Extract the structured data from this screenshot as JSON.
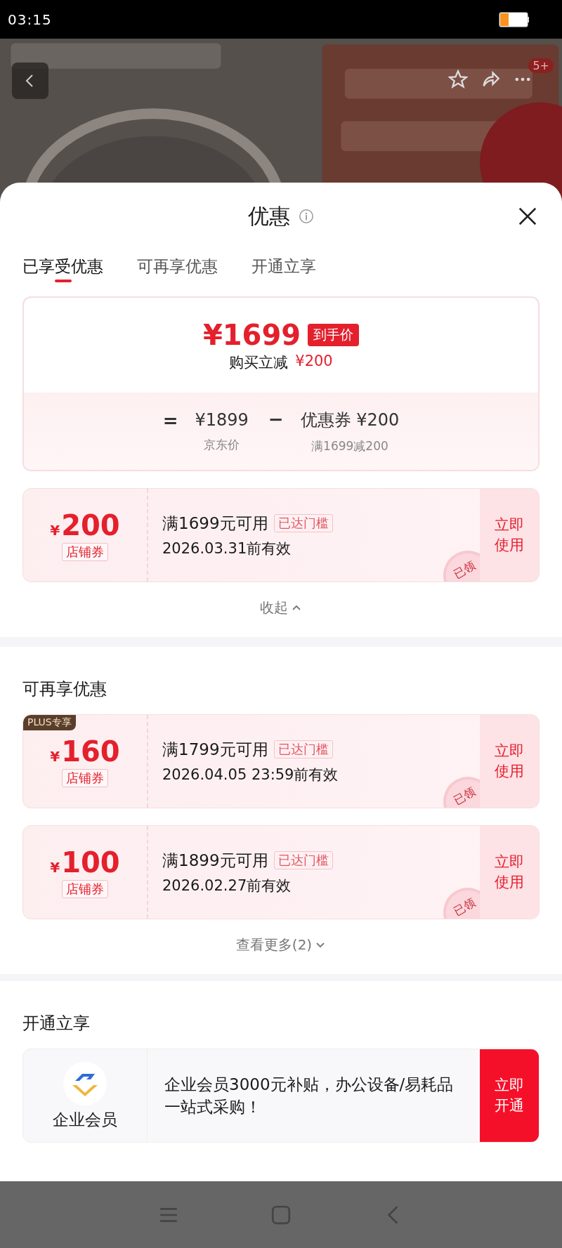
{
  "status_bar": {
    "time": "03:15"
  },
  "header": {
    "cart_badge": "5+"
  },
  "sheet": {
    "title": "优惠",
    "tabs": [
      {
        "label": "已享受优惠",
        "selected": true
      },
      {
        "label": "可再享优惠",
        "selected": false
      },
      {
        "label": "开通立享",
        "selected": false
      }
    ],
    "summary": {
      "price": "¥1699",
      "price_tag": "到手价",
      "saving_label": "购买立减",
      "saving_amount": "¥200",
      "terms": [
        {
          "symbol": "=",
          "value": "¥1899",
          "label": "京东价"
        },
        {
          "symbol": "−",
          "value": "优惠券 ¥200",
          "label": "满1699减200"
        }
      ]
    },
    "applied_coupons": [
      {
        "currency": "¥",
        "amount": "200",
        "type": "店铺券",
        "condition": "满1699元可用",
        "tag": "已达门槛",
        "validity": "2026.03.31前有效",
        "action": "立即使用",
        "stamp": "已领"
      }
    ],
    "collapse_link": "收起",
    "more_section": {
      "title": "可再享优惠",
      "coupons": [
        {
          "badge": "PLUS专享",
          "currency": "¥",
          "amount": "160",
          "type": "店铺券",
          "condition": "满1799元可用",
          "tag": "已达门槛",
          "validity": "2026.04.05 23:59前有效",
          "action": "立即使用",
          "stamp": "已领"
        },
        {
          "currency": "¥",
          "amount": "100",
          "type": "店铺券",
          "condition": "满1899元可用",
          "tag": "已达门槛",
          "validity": "2026.02.27前有效",
          "action": "立即使用",
          "stamp": "已领"
        }
      ],
      "more_link": "查看更多(2)"
    },
    "open_section": {
      "title": "开通立享",
      "card": {
        "name": "企业会员",
        "text": "企业会员3000元补贴，办公设备/易耗品一站式采购！",
        "action": "立即开通"
      }
    }
  }
}
